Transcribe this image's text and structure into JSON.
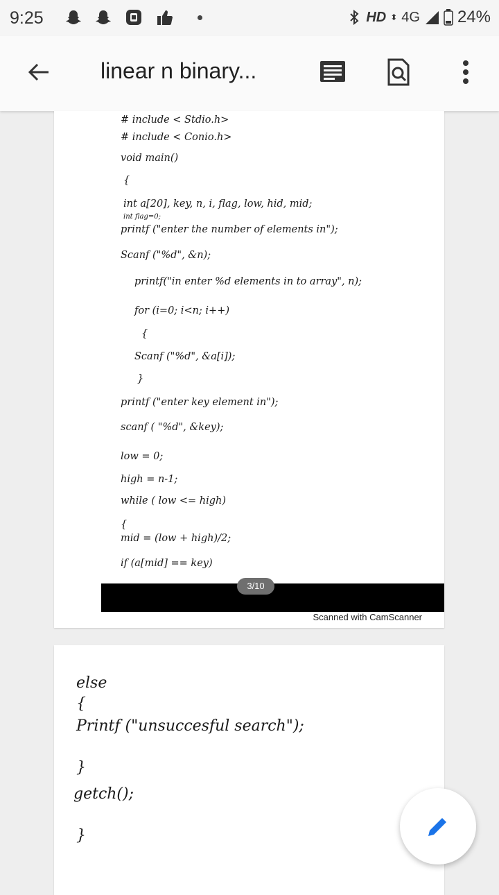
{
  "status_bar": {
    "time": "9:25",
    "network": "HD",
    "signal": "4G",
    "battery": "24%"
  },
  "app_bar": {
    "title": "linear n binary...",
    "back_icon": "arrow-left-icon",
    "actions": [
      "document-text-icon",
      "search-page-icon",
      "more-vert-icon"
    ]
  },
  "document": {
    "page1": {
      "lines": [
        "# include < Stdio.h>",
        "# include < Conio.h>",
        "void main()",
        "{",
        "int a[20], key, n, i, flag, low, hid, mid;",
        "int flag=0;",
        "printf (\"enter the number of elements in\");",
        "Scanf (\"%d\", &n);",
        "printf(\"in enter %d elements in to array\", n);",
        "for (i=0; i<n; i++)",
        "{",
        "Scanf (\"%d\", &a[i]);",
        "}",
        "printf (\"enter key element in\");",
        "scanf ( \"%d\", &key);",
        "low = 0;",
        "high = n-1;",
        "while ( low <= high)",
        "{",
        "mid = (low + high)/2;",
        "if (a[mid] == key)"
      ],
      "page_indicator": "3/10",
      "watermark": "Scanned with CamScanner"
    },
    "page2": {
      "lines": [
        "else",
        "{",
        "Printf (\"unsuccesful search\");",
        "}",
        "getch();",
        "}"
      ]
    }
  },
  "fab": {
    "icon": "pencil-edit-icon"
  }
}
